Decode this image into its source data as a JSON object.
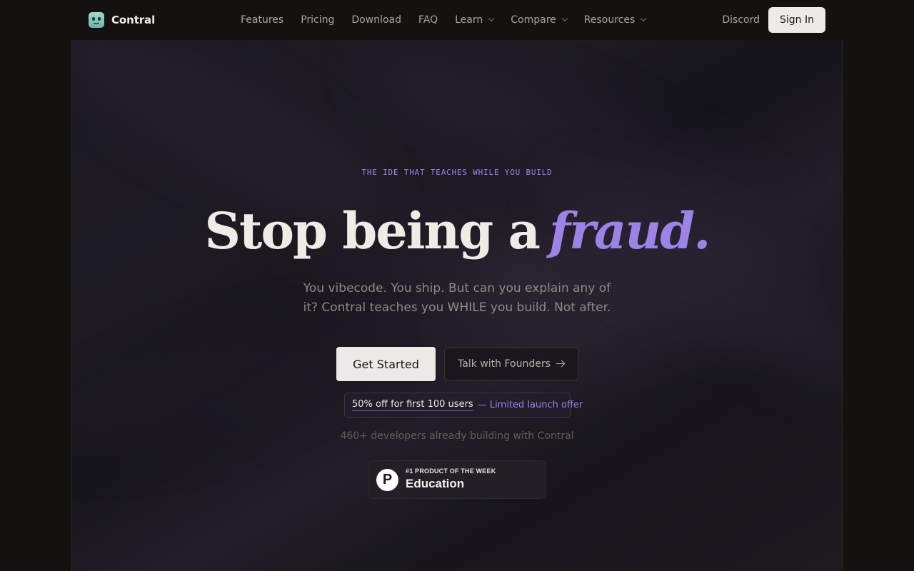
{
  "brand": {
    "name": "Contral",
    "logo_icon": "robot-face-icon"
  },
  "nav": {
    "items": [
      {
        "label": "Features",
        "has_dropdown": false
      },
      {
        "label": "Pricing",
        "has_dropdown": false
      },
      {
        "label": "Download",
        "has_dropdown": false
      },
      {
        "label": "FAQ",
        "has_dropdown": false
      },
      {
        "label": "Learn",
        "has_dropdown": true
      },
      {
        "label": "Compare",
        "has_dropdown": true
      },
      {
        "label": "Resources",
        "has_dropdown": true
      }
    ],
    "discord": "Discord",
    "sign_in": "Sign In"
  },
  "hero": {
    "eyebrow": "THE IDE THAT TEACHES WHILE YOU BUILD",
    "headline_main": "Stop being a",
    "headline_accent": "fraud.",
    "subhead": "You vibecode. You ship. But can you explain any of it? Contral teaches you WHILE you build. Not after.",
    "primary_cta": "Get Started",
    "secondary_cta": "Talk with Founders",
    "offer_main": "50% off for first 100 users",
    "offer_sub": "— Limited launch offer",
    "social_proof": "460+ developers already building with Contral",
    "badge": {
      "logo_letter": "P",
      "eyebrow": "#1 PRODUCT OF THE WEEK",
      "title": "Education"
    }
  },
  "colors": {
    "background": "#13120f",
    "accent": "#9b84e6",
    "primary_button": "#ebeae6"
  }
}
